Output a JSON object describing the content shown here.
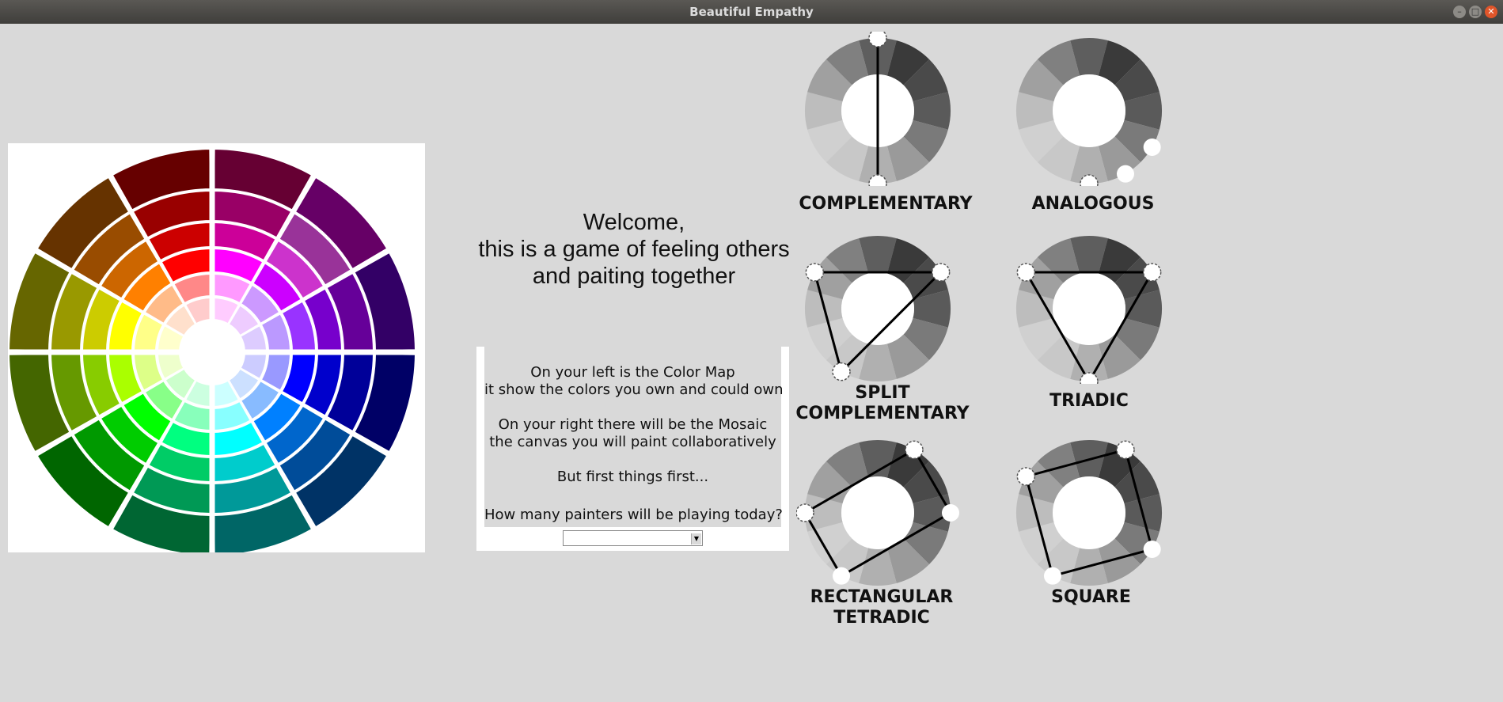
{
  "window": {
    "title": "Beautiful Empathy",
    "controls": [
      "minimize",
      "maximize",
      "close"
    ]
  },
  "colormap": {
    "colors": {
      "rings": [
        [
          "#660033",
          "#990066",
          "#cc0099",
          "#ff00ff",
          "#ff99ff",
          "#ffccff"
        ],
        [
          "#660066",
          "#993399",
          "#cc33cc",
          "#cc00ff",
          "#cc99ff",
          "#eeccff"
        ],
        [
          "#330066",
          "#660099",
          "#7700cc",
          "#9933ff",
          "#bb99ff",
          "#ddccff"
        ],
        [
          "#000066",
          "#000099",
          "#0000cc",
          "#0000ff",
          "#9999ff",
          "#ccccff"
        ],
        [
          "#003366",
          "#004c99",
          "#0066cc",
          "#0080ff",
          "#88bbff",
          "#cce0ff"
        ],
        [
          "#006666",
          "#009999",
          "#00cccc",
          "#00ffff",
          "#88ffff",
          "#ccffff"
        ],
        [
          "#006633",
          "#009955",
          "#00cc66",
          "#00ff80",
          "#88ffbb",
          "#ccffe0"
        ],
        [
          "#006600",
          "#009900",
          "#00cc00",
          "#00ff00",
          "#88ff88",
          "#ccffcc"
        ],
        [
          "#446600",
          "#669900",
          "#88cc00",
          "#aaff00",
          "#ddff88",
          "#eeffcc"
        ],
        [
          "#666600",
          "#999900",
          "#cccc00",
          "#ffff00",
          "#ffff88",
          "#ffffcc"
        ],
        [
          "#663300",
          "#994c00",
          "#cc6600",
          "#ff8000",
          "#ffbb88",
          "#ffe0cc"
        ],
        [
          "#660000",
          "#990000",
          "#cc0000",
          "#ff0000",
          "#ff8888",
          "#ffcccc"
        ]
      ]
    }
  },
  "welcome": {
    "lines": [
      "Welcome,",
      "this is a game of feeling others",
      "and paiting together"
    ]
  },
  "intro": {
    "lines": [
      "On your left is the Color Map",
      "it show the colors you own and could own",
      "",
      "On your right there will be the Mosaic",
      "the canvas you will paint collaboratively",
      "",
      "But first things first...",
      "",
      "How many painters will be playing today?"
    ],
    "painter_count_value": ""
  },
  "harmonies": [
    {
      "label": "COMPLEMENTARY",
      "markers": [
        0,
        6
      ],
      "shape": "line",
      "filled": []
    },
    {
      "label": "ANALOGOUS",
      "markers": [
        4,
        5,
        6
      ],
      "shape": "none",
      "filled": [
        4,
        5
      ]
    },
    {
      "label": "SPLIT\nCOMPLEMENTARY",
      "markers": [
        2,
        7,
        10
      ],
      "shape": "polygon",
      "filled": []
    },
    {
      "label": "TRIADIC",
      "markers": [
        2,
        6,
        10
      ],
      "shape": "polygon",
      "filled": []
    },
    {
      "label": "RECTANGULAR\nTETRADIC",
      "markers": [
        1,
        3,
        7,
        9
      ],
      "shape": "polygon",
      "filled": [
        3,
        7
      ]
    },
    {
      "label": "SQUARE",
      "markers": [
        1,
        4,
        7,
        10
      ],
      "shape": "polygon",
      "filled": [
        4,
        7
      ]
    }
  ]
}
